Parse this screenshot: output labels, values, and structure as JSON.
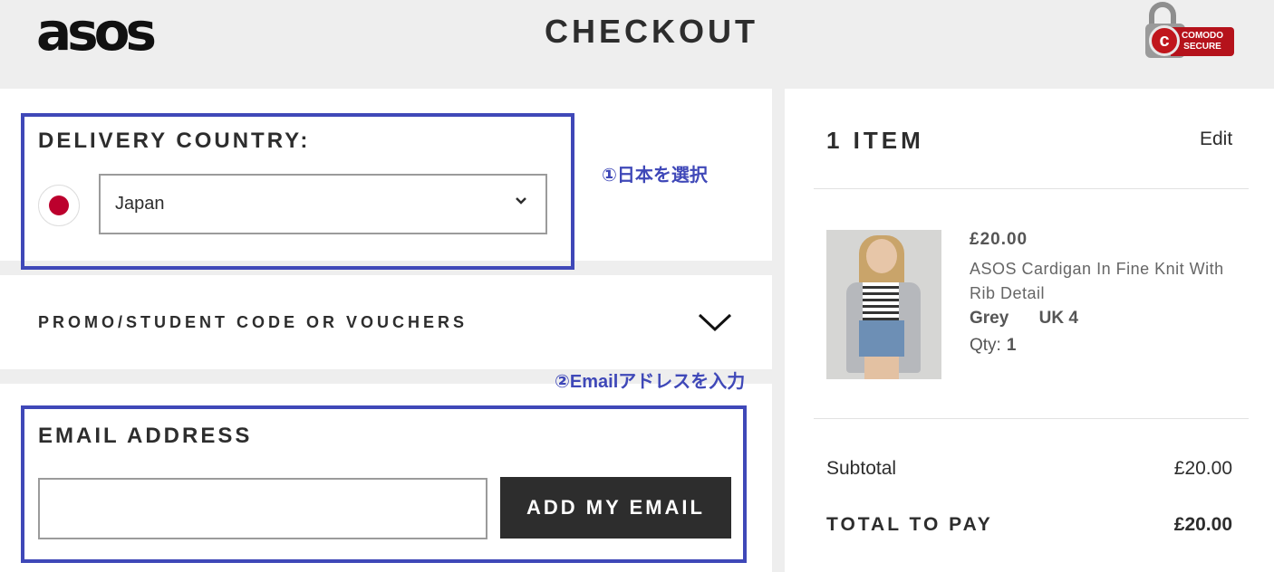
{
  "header": {
    "logo_text": "asos",
    "title": "CHECKOUT",
    "secure_badge": {
      "brand": "COMODO",
      "text": "SECURE",
      "icon": "padlock-icon"
    }
  },
  "delivery": {
    "title": "DELIVERY COUNTRY:",
    "flag_icon": "japan-flag-icon",
    "selected_country": "Japan"
  },
  "promo": {
    "label": "PROMO/STUDENT CODE OR VOUCHERS"
  },
  "email": {
    "title": "EMAIL ADDRESS",
    "value": "",
    "placeholder": "",
    "button_label": "ADD MY EMAIL"
  },
  "annotations": {
    "step1": "①日本を選択",
    "step2": "②Emailアドレスを入力",
    "highlight_color": "#3f48b8"
  },
  "summary": {
    "items_title": "1 ITEM",
    "edit_label": "Edit",
    "product": {
      "price": "£20.00",
      "name": "ASOS Cardigan In Fine Knit With Rib Detail",
      "color": "Grey",
      "size": "UK 4",
      "qty_label": "Qty:",
      "qty": "1"
    },
    "subtotal_label": "Subtotal",
    "subtotal_value": "£20.00",
    "total_label": "TOTAL TO PAY",
    "total_value": "£20.00"
  }
}
